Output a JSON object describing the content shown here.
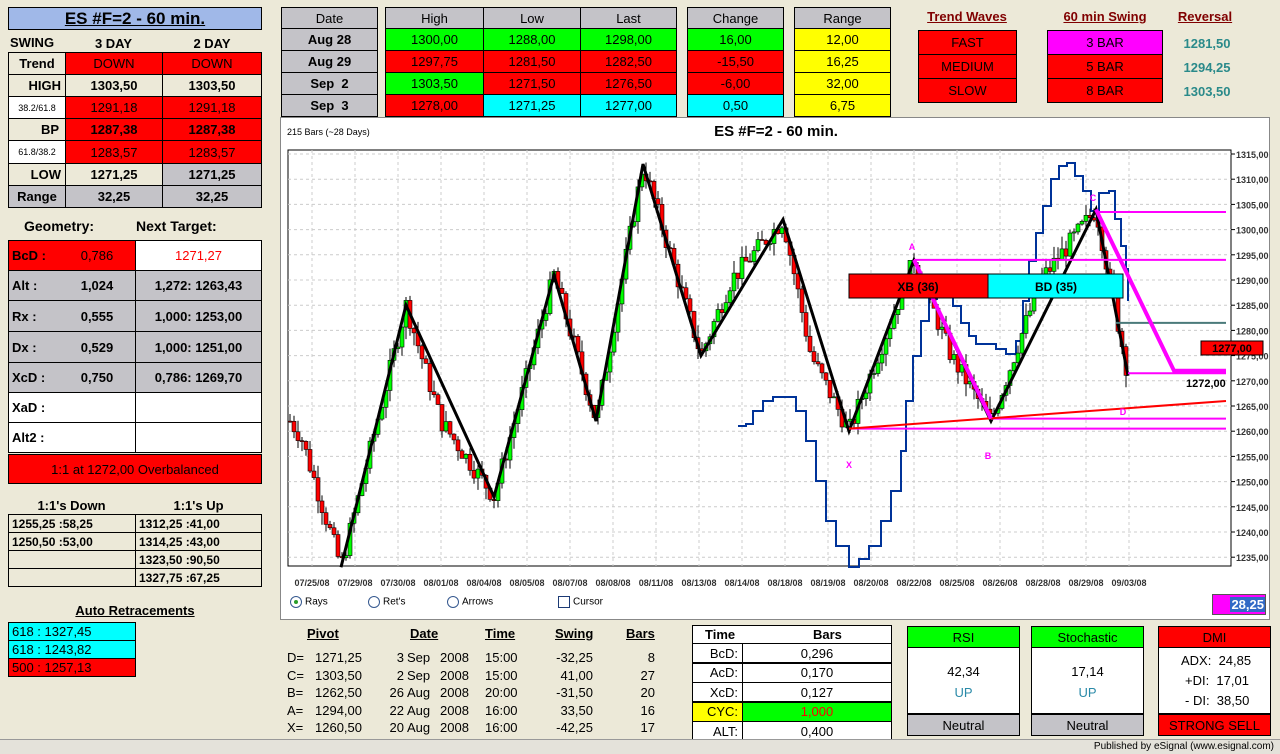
{
  "title": "ES #F=2 - 60 min.",
  "swing": {
    "label": "SWING",
    "col1": "3 DAY",
    "col2": "2 DAY",
    "rows": [
      {
        "label": "Trend",
        "v1": "DOWN",
        "v2": "DOWN"
      },
      {
        "label": "HIGH",
        "v1": "1303,50",
        "v2": "1303,50"
      },
      {
        "label": "38.2/61.8",
        "v1": "1291,18",
        "v2": "1291,18"
      },
      {
        "label": "BP",
        "v1": "1287,38",
        "v2": "1287,38"
      },
      {
        "label": "61.8/38.2",
        "v1": "1283,57",
        "v2": "1283,57"
      },
      {
        "label": "LOW",
        "v1": "1271,25",
        "v2": "1271,25"
      },
      {
        "label": "Range",
        "v1": "32,25",
        "v2": "32,25"
      }
    ]
  },
  "geometry": {
    "label": "Geometry:",
    "next_label": "Next Target:",
    "rows": [
      {
        "label": "BcD  :",
        "val": "0,786",
        "target": "1271,27"
      },
      {
        "label": "Alt  :",
        "val": "1,024",
        "target": "1,272: 1263,43"
      },
      {
        "label": "Rx   :",
        "val": "0,555",
        "target": "1,000: 1253,00"
      },
      {
        "label": "Dx   :",
        "val": "0,529",
        "target": "1,000: 1251,00"
      },
      {
        "label": "XcD  :",
        "val": "0,750",
        "target": "0,786: 1269,70"
      },
      {
        "label": "XaD  :",
        "val": "",
        "target": ""
      },
      {
        "label": "Alt2  :",
        "val": "",
        "target": ""
      }
    ],
    "status": "1:1 at 1272,00 Overbalanced"
  },
  "ones": {
    "down_label": "1:1's Down",
    "up_label": "1:1's Up",
    "down": [
      "1255,25 :58,25",
      "1250,50 :53,00",
      "",
      ""
    ],
    "up": [
      "1312,25 :41,00",
      "1314,25 :43,00",
      "1323,50 :90,50",
      "1327,75 :67,25"
    ]
  },
  "retracements": {
    "label": "Auto Retracements",
    "items": [
      "618 : 1327,45",
      "618 : 1243,82",
      "500 : 1257,13"
    ]
  },
  "daily": {
    "headers": [
      "Date",
      "High",
      "Low",
      "Last",
      "Change",
      "Range"
    ],
    "rows": [
      {
        "date": "Aug 28",
        "high": "1300,00",
        "low": "1288,00",
        "last": "1298,00",
        "change": "16,00",
        "range": "12,00"
      },
      {
        "date": "Aug 29",
        "high": "1297,75",
        "low": "1281,50",
        "last": "1282,50",
        "change": "-15,50",
        "range": "16,25"
      },
      {
        "date": "Sep  2",
        "high": "1303,50",
        "low": "1271,50",
        "last": "1276,50",
        "change": "-6,00",
        "range": "32,00"
      },
      {
        "date": "Sep  3",
        "high": "1278,00",
        "low": "1271,25",
        "last": "1277,00",
        "change": "0,50",
        "range": "6,75"
      }
    ]
  },
  "waves": {
    "trend_label": "Trend Waves",
    "swing_label": "60 min Swing",
    "reversal_label": "Reversal",
    "trend": [
      "FAST",
      "MEDIUM",
      "SLOW"
    ],
    "swing": [
      "3 BAR",
      "5 BAR",
      "8 BAR"
    ],
    "reversal": [
      "1281,50",
      "1294,25",
      "1303,50"
    ]
  },
  "chart": {
    "bars_info": "215 Bars (~28 Days)",
    "title": "ES #F=2 - 60 min.",
    "y_ticks": [
      "1315,00",
      "1310,00",
      "1305,00",
      "1300,00",
      "1295,00",
      "1290,00",
      "1285,00",
      "1280,00",
      "1275,00",
      "1270,00",
      "1265,00",
      "1260,00",
      "1255,00",
      "1250,00",
      "1245,00",
      "1240,00",
      "1235,00"
    ],
    "x_ticks": [
      "07/25/08",
      "07/29/08",
      "07/30/08",
      "08/01/08",
      "08/04/08",
      "08/05/08",
      "08/07/08",
      "08/08/08",
      "08/11/08",
      "08/13/08",
      "08/14/08",
      "08/18/08",
      "08/19/08",
      "08/20/08",
      "08/22/08",
      "08/25/08",
      "08/26/08",
      "08/28/08",
      "08/29/08",
      "09/03/08"
    ],
    "xb_label": "XB (36)",
    "bd_label": "BD (35)",
    "points": {
      "a": "A",
      "b": "B",
      "c": "C",
      "d": "D",
      "x": "X"
    },
    "last_price": "1277,00",
    "target_price": "1272,00",
    "options": {
      "rays": "Rays",
      "rets": "Ret's",
      "arrows": "Arrows",
      "cursor": "Cursor"
    },
    "readout": "28,25",
    "colors": {
      "up": "#00ff00",
      "down": "#ff0000",
      "pattern": "#ff00ff",
      "oscillator": "#003399"
    }
  },
  "pivots": {
    "headers": [
      "Pivot",
      "Date",
      "Time",
      "Swing",
      "Bars"
    ],
    "rows": [
      {
        "p": "D=",
        "price": "1271,25",
        "day": "3",
        "mon": "Sep",
        "yr": "2008",
        "time": "15:00",
        "swing": "-32,25",
        "bars": "8"
      },
      {
        "p": "C=",
        "price": "1303,50",
        "day": "2",
        "mon": "Sep",
        "yr": "2008",
        "time": "15:00",
        "swing": "41,00",
        "bars": "27"
      },
      {
        "p": "B=",
        "price": "1262,50",
        "day": "26",
        "mon": "Aug",
        "yr": "2008",
        "time": "20:00",
        "swing": "-31,50",
        "bars": "20"
      },
      {
        "p": "A=",
        "price": "1294,00",
        "day": "22",
        "mon": "Aug",
        "yr": "2008",
        "time": "16:00",
        "swing": "33,50",
        "bars": "16"
      },
      {
        "p": "X=",
        "price": "1260,50",
        "day": "20",
        "mon": "Aug",
        "yr": "2008",
        "time": "16:00",
        "swing": "-42,25",
        "bars": "17"
      }
    ]
  },
  "timebars": {
    "h1": "Time",
    "h2": "Bars",
    "rows": [
      {
        "l": "BcD:",
        "v": "0,296"
      },
      {
        "l": "AcD:",
        "v": "0,170"
      },
      {
        "l": "XcD:",
        "v": "0,127"
      },
      {
        "l": "CYC:",
        "v": "1,000"
      },
      {
        "l": "ALT:",
        "v": "0,400"
      }
    ]
  },
  "rsi": {
    "label": "RSI",
    "value": "42,34",
    "dir": "UP",
    "status": "Neutral"
  },
  "stoch": {
    "label": "Stochastic",
    "value": "17,14",
    "dir": "UP",
    "status": "Neutral"
  },
  "dmi": {
    "label": "DMI",
    "adx": "ADX:  24,85",
    "pdi": "+DI:  17,01",
    "mdi": "- DI:  38,50",
    "status": "STRONG SELL"
  },
  "footer": "Published by eSignal (www.esignal.com)"
}
